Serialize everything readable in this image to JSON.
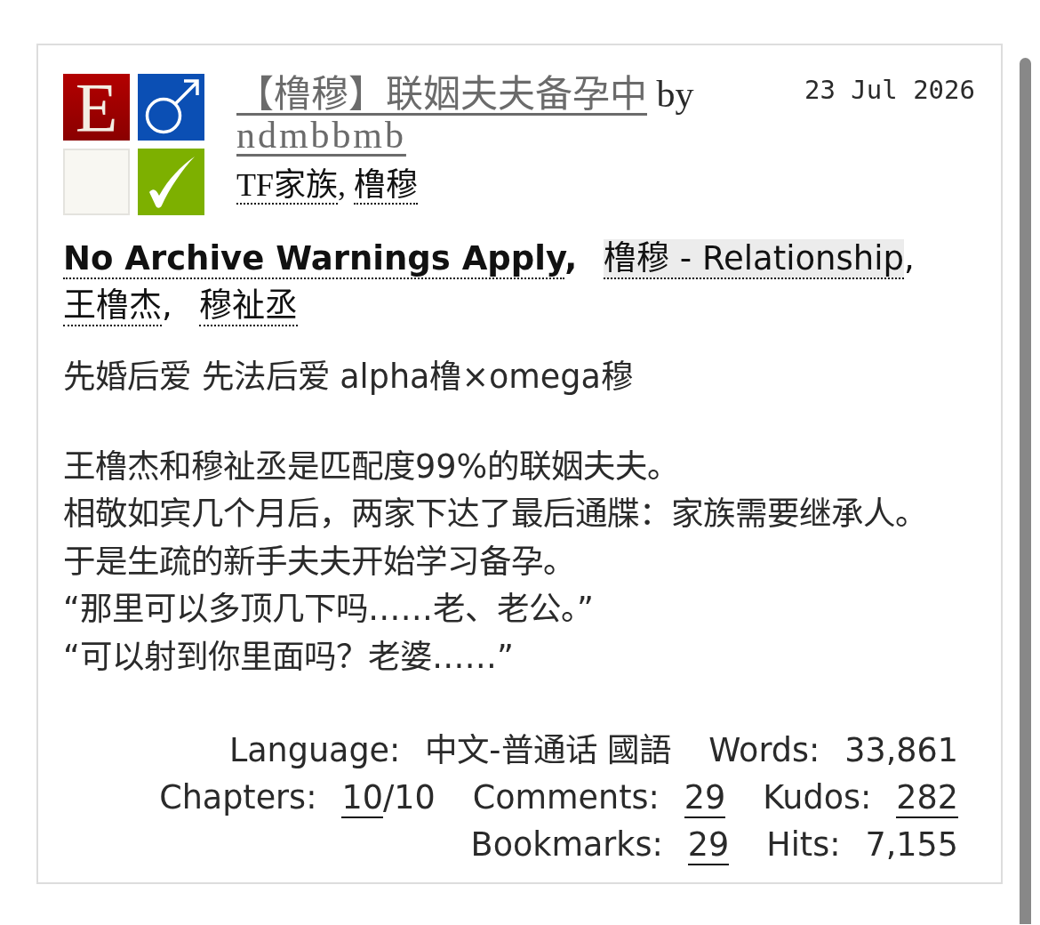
{
  "work": {
    "required_tags": [
      {
        "kind": "rating",
        "text": "E"
      },
      {
        "kind": "male"
      },
      {
        "kind": "blank"
      },
      {
        "kind": "check"
      }
    ],
    "title": "【橹穆】联姻夫夫备孕中",
    "byline": "by",
    "author": "ndmbbmb",
    "date": "23 Jul 2026",
    "fandoms": [
      {
        "text": "TF家族",
        "separator": ","
      },
      {
        "text": "橹穆"
      }
    ],
    "tags": [
      {
        "kind": "warning",
        "text": "No Archive Warnings Apply",
        "highlighted": false,
        "separator": ","
      },
      {
        "kind": "relationship",
        "text": "橹穆 - Relationship",
        "highlighted": true,
        "separator": ","
      },
      {
        "kind": "character",
        "text": "王橹杰",
        "highlighted": false,
        "separator": ","
      },
      {
        "kind": "character",
        "text": "穆祉丞",
        "highlighted": false
      }
    ],
    "summary": [
      {
        "lines": [
          "先婚后爱 先法后爱 alpha橹×omega穆"
        ]
      },
      {
        "lines": [
          "王橹杰和穆祉丞是匹配度99%的联姻夫夫。",
          "相敬如宾几个月后，两家下达了最后通牒：家族需要继承人。",
          "于是生疏的新手夫夫开始学习备孕。",
          "“那里可以多顶几下吗……老、老公。”",
          "“可以射到你里面吗？老婆……”"
        ]
      }
    ],
    "stats": [
      {
        "items": [
          {
            "label": "Language:",
            "value": "中文-普通话 國語",
            "linked": false
          },
          {
            "label": "Words:",
            "value": "33,861",
            "linked": false
          }
        ]
      },
      {
        "items": [
          {
            "label": "Chapters:",
            "value": "10",
            "linked": true,
            "suffix": "/10"
          },
          {
            "label": "Comments:",
            "value": "29",
            "linked": true
          },
          {
            "label": "Kudos:",
            "value": "282",
            "linked": true
          }
        ]
      },
      {
        "items": [
          {
            "label": "Bookmarks:",
            "value": "29",
            "linked": true
          },
          {
            "label": "Hits:",
            "value": "7,155",
            "linked": false
          }
        ]
      }
    ]
  }
}
